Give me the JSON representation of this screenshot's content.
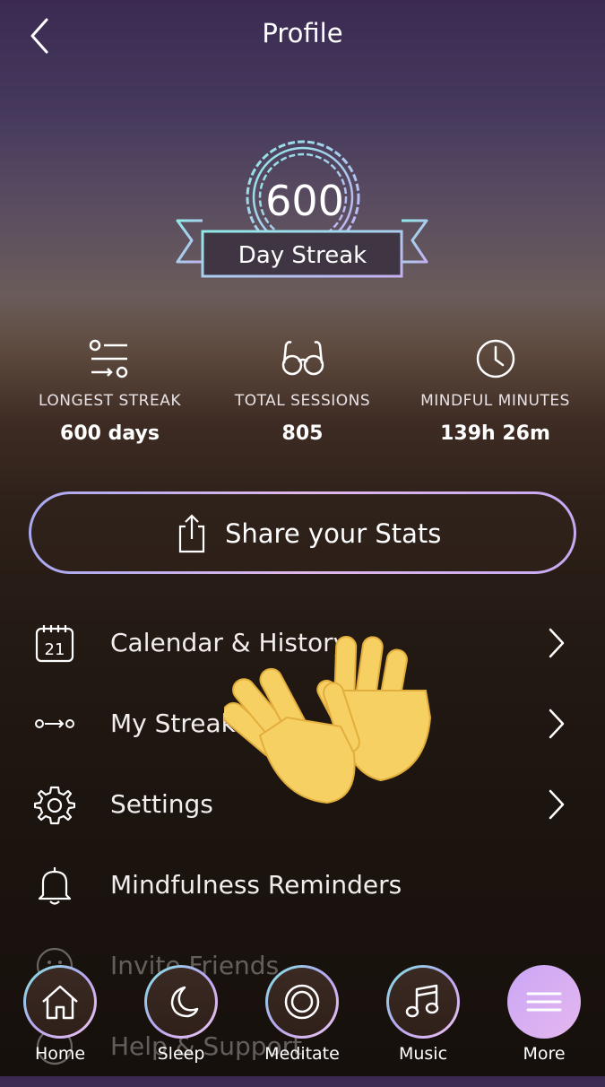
{
  "header": {
    "title": "Profile"
  },
  "badge": {
    "number": "600",
    "label": "Day Streak"
  },
  "stats": [
    {
      "label": "LONGEST STREAK",
      "value": "600 days",
      "icon": "streak-lines-icon"
    },
    {
      "label": "TOTAL SESSIONS",
      "value": "805",
      "icon": "glasses-icon"
    },
    {
      "label": "MINDFUL MINUTES",
      "value": "139h 26m",
      "icon": "clock-icon"
    }
  ],
  "share": {
    "label": "Share your Stats"
  },
  "calendar_day": "21",
  "menu": [
    {
      "label": "Calendar & History"
    },
    {
      "label": "My Streak"
    },
    {
      "label": "Settings"
    },
    {
      "label": "Mindfulness Reminders"
    },
    {
      "label": "Invite Friends"
    },
    {
      "label": "Help & Support"
    }
  ],
  "tabs": [
    {
      "label": "Home"
    },
    {
      "label": "Sleep"
    },
    {
      "label": "Meditate"
    },
    {
      "label": "Music"
    },
    {
      "label": "More"
    }
  ],
  "colors": {
    "accent_purple": "#c9a6f5",
    "accent_teal": "#7fe4e0",
    "emoji_yellow": "#f7d064"
  }
}
